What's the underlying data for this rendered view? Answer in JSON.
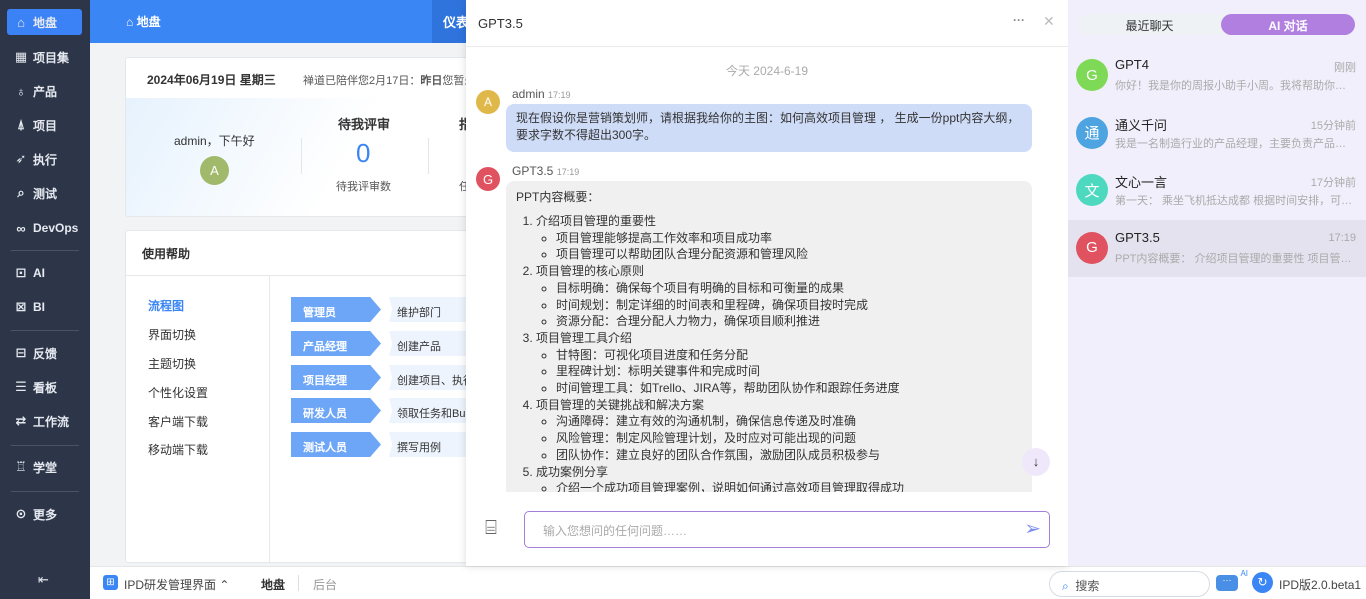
{
  "sidebar": {
    "items": [
      {
        "label": "地盘",
        "icon": "home-icon"
      },
      {
        "label": "项目集",
        "icon": "grid-icon"
      },
      {
        "label": "产品",
        "icon": "bulb-icon"
      },
      {
        "label": "项目",
        "icon": "rocket-icon"
      },
      {
        "label": "执行",
        "icon": "run-icon"
      },
      {
        "label": "测试",
        "icon": "search-bug-icon"
      },
      {
        "label": "DevOps",
        "icon": "infinity-icon"
      },
      {
        "label": "AI",
        "icon": "robot-icon"
      },
      {
        "label": "BI",
        "icon": "chart-board-icon"
      },
      {
        "label": "反馈",
        "icon": "feedback-icon"
      },
      {
        "label": "看板",
        "icon": "kanban-icon"
      },
      {
        "label": "工作流",
        "icon": "workflow-icon"
      },
      {
        "label": "学堂",
        "icon": "school-icon"
      },
      {
        "label": "更多",
        "icon": "more-icon"
      }
    ],
    "collapse_icon": "collapse-left-icon"
  },
  "topbar": {
    "title": "地盘",
    "tab": "仪表"
  },
  "dashboard": {
    "date": "2024年06月19日 星期三",
    "companion": "禅道已陪伴您2月17日：",
    "yesterday_label": "昨日",
    "yesterday_text": "您暂未",
    "greeting": "admin，下午好",
    "avatar_letter": "A",
    "review_title": "待我评审",
    "review_count": "0",
    "review_sub": "待我评审数",
    "col2_title": "指",
    "col2_sub": "任"
  },
  "help": {
    "title": "使用帮助",
    "menu": [
      "流程图",
      "界面切换",
      "主题切换",
      "个性化设置",
      "客户端下载",
      "移动端下载"
    ],
    "roles": [
      {
        "role": "管理员",
        "task": "维护部门"
      },
      {
        "role": "产品经理",
        "task": "创建产品"
      },
      {
        "role": "项目经理",
        "task": "创建项目、执行"
      },
      {
        "role": "研发人员",
        "task": "领取任务和Bug"
      },
      {
        "role": "测试人员",
        "task": "撰写用例"
      }
    ]
  },
  "bottombar": {
    "app": "IPD研发管理界面",
    "tab_active": "地盘",
    "tab_other": "后台",
    "search_placeholder": "搜索",
    "ai_badge": "AI",
    "version": "IPD版2.0.beta1"
  },
  "chat": {
    "title": "GPT3.5",
    "date": "今天 2024-6-19",
    "user": {
      "name": "admin",
      "time": "17:19",
      "avatar": "A",
      "text": "现在假设你是营销策划师，请根据我给你的主图：如何高效项目管理 ， 生成一份ppt内容大纲，要求字数不得超出300字。"
    },
    "bot": {
      "name": "GPT3.5",
      "time": "17:19",
      "avatar": "G",
      "intro": "PPT内容概要：",
      "sections": [
        {
          "title": "介绍项目管理的重要性",
          "items": [
            "项目管理能够提高工作效率和项目成功率",
            "项目管理可以帮助团队合理分配资源和管理风险"
          ]
        },
        {
          "title": "项目管理的核心原则",
          "items": [
            "目标明确：确保每个项目有明确的目标和可衡量的成果",
            "时间规划：制定详细的时间表和里程碑，确保项目按时完成",
            "资源分配：合理分配人力物力，确保项目顺利推进"
          ]
        },
        {
          "title": "项目管理工具介绍",
          "items": [
            "甘特图：可视化项目进度和任务分配",
            "里程碑计划：标明关键事件和完成时间",
            "时间管理工具：如Trello、JIRA等，帮助团队协作和跟踪任务进度"
          ]
        },
        {
          "title": "项目管理的关键挑战和解决方案",
          "items": [
            "沟通障碍：建立有效的沟通机制，确保信息传递及时准确",
            "风险管理：制定风险管理计划，及时应对可能出现的问题",
            "团队协作：建立良好的团队合作氛围，激励团队成员积极参与"
          ]
        },
        {
          "title": "成功案例分享",
          "items": [
            "介绍一个成功项目管理案例，说明如何通过高效项目管理取得成功"
          ]
        }
      ]
    },
    "input_placeholder": "输入您想问的任何问题……"
  },
  "right": {
    "tabs": [
      "最近聊天",
      "AI 对话"
    ],
    "active_tab": 1,
    "conversations": [
      {
        "avatar": "G",
        "color": "#7ed957",
        "name": "GPT4",
        "time": "刚刚",
        "preview": "你好！我是你的周报小助手小周。我将帮助你轻松完成周报"
      },
      {
        "avatar": "通",
        "color": "#4ea4e0",
        "name": "通义千问",
        "time": "15分钟前",
        "preview": "我是一名制造行业的产品经理，主要负责产品设计与规划"
      },
      {
        "avatar": "文",
        "color": "#4dd9c0",
        "name": "文心一言",
        "time": "17分钟前",
        "preview": "第一天： 乘坐飞机抵达成都 根据时间安排，可以先去"
      },
      {
        "avatar": "G",
        "color": "#e05260",
        "name": "GPT3.5",
        "time": "17:19",
        "preview": "PPT内容概要： 介绍项目管理的重要性 项目管理能够提高"
      }
    ]
  },
  "colors": {
    "sidebar": "#2d3648",
    "primary": "#3a86f5",
    "ai_purple": "#b07fe0",
    "user_bubble": "#cfdcf8"
  }
}
